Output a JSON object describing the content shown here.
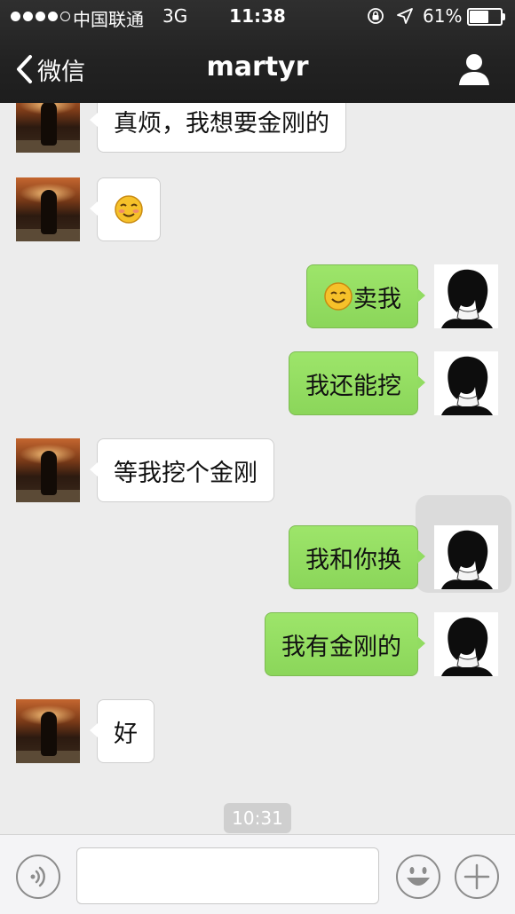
{
  "status_bar": {
    "carrier": "中国联通",
    "network": "3G",
    "time": "11:38",
    "battery_percent": "61%",
    "battery_level": 0.61
  },
  "nav": {
    "back_label": "微信",
    "title": "martyr",
    "icons": {
      "back": "chevron-left-icon",
      "profile": "person-icon"
    }
  },
  "messages": [
    {
      "from": "them",
      "text": "真烦，我想要金刚的"
    },
    {
      "from": "them",
      "text": "",
      "emoji": "shy-smile-emoji-icon"
    },
    {
      "from": "me",
      "text": "卖我",
      "emoji": "smile-emoji-icon"
    },
    {
      "from": "me",
      "text": "我还能挖"
    },
    {
      "from": "them",
      "text": "等我挖个金刚"
    },
    {
      "from": "me",
      "text": "我和你换"
    },
    {
      "from": "me",
      "text": "我有金刚的"
    },
    {
      "from": "them",
      "text": "好"
    }
  ],
  "timestamp": "10:31",
  "input_bar": {
    "text_value": "",
    "icons": {
      "voice": "voice-icon",
      "emoji": "emoji-icon",
      "more": "plus-icon"
    }
  },
  "colors": {
    "nav_bg": "#222222",
    "chat_bg": "#ececec",
    "my_bubble": "#8bd65a",
    "their_bubble": "#ffffff"
  }
}
